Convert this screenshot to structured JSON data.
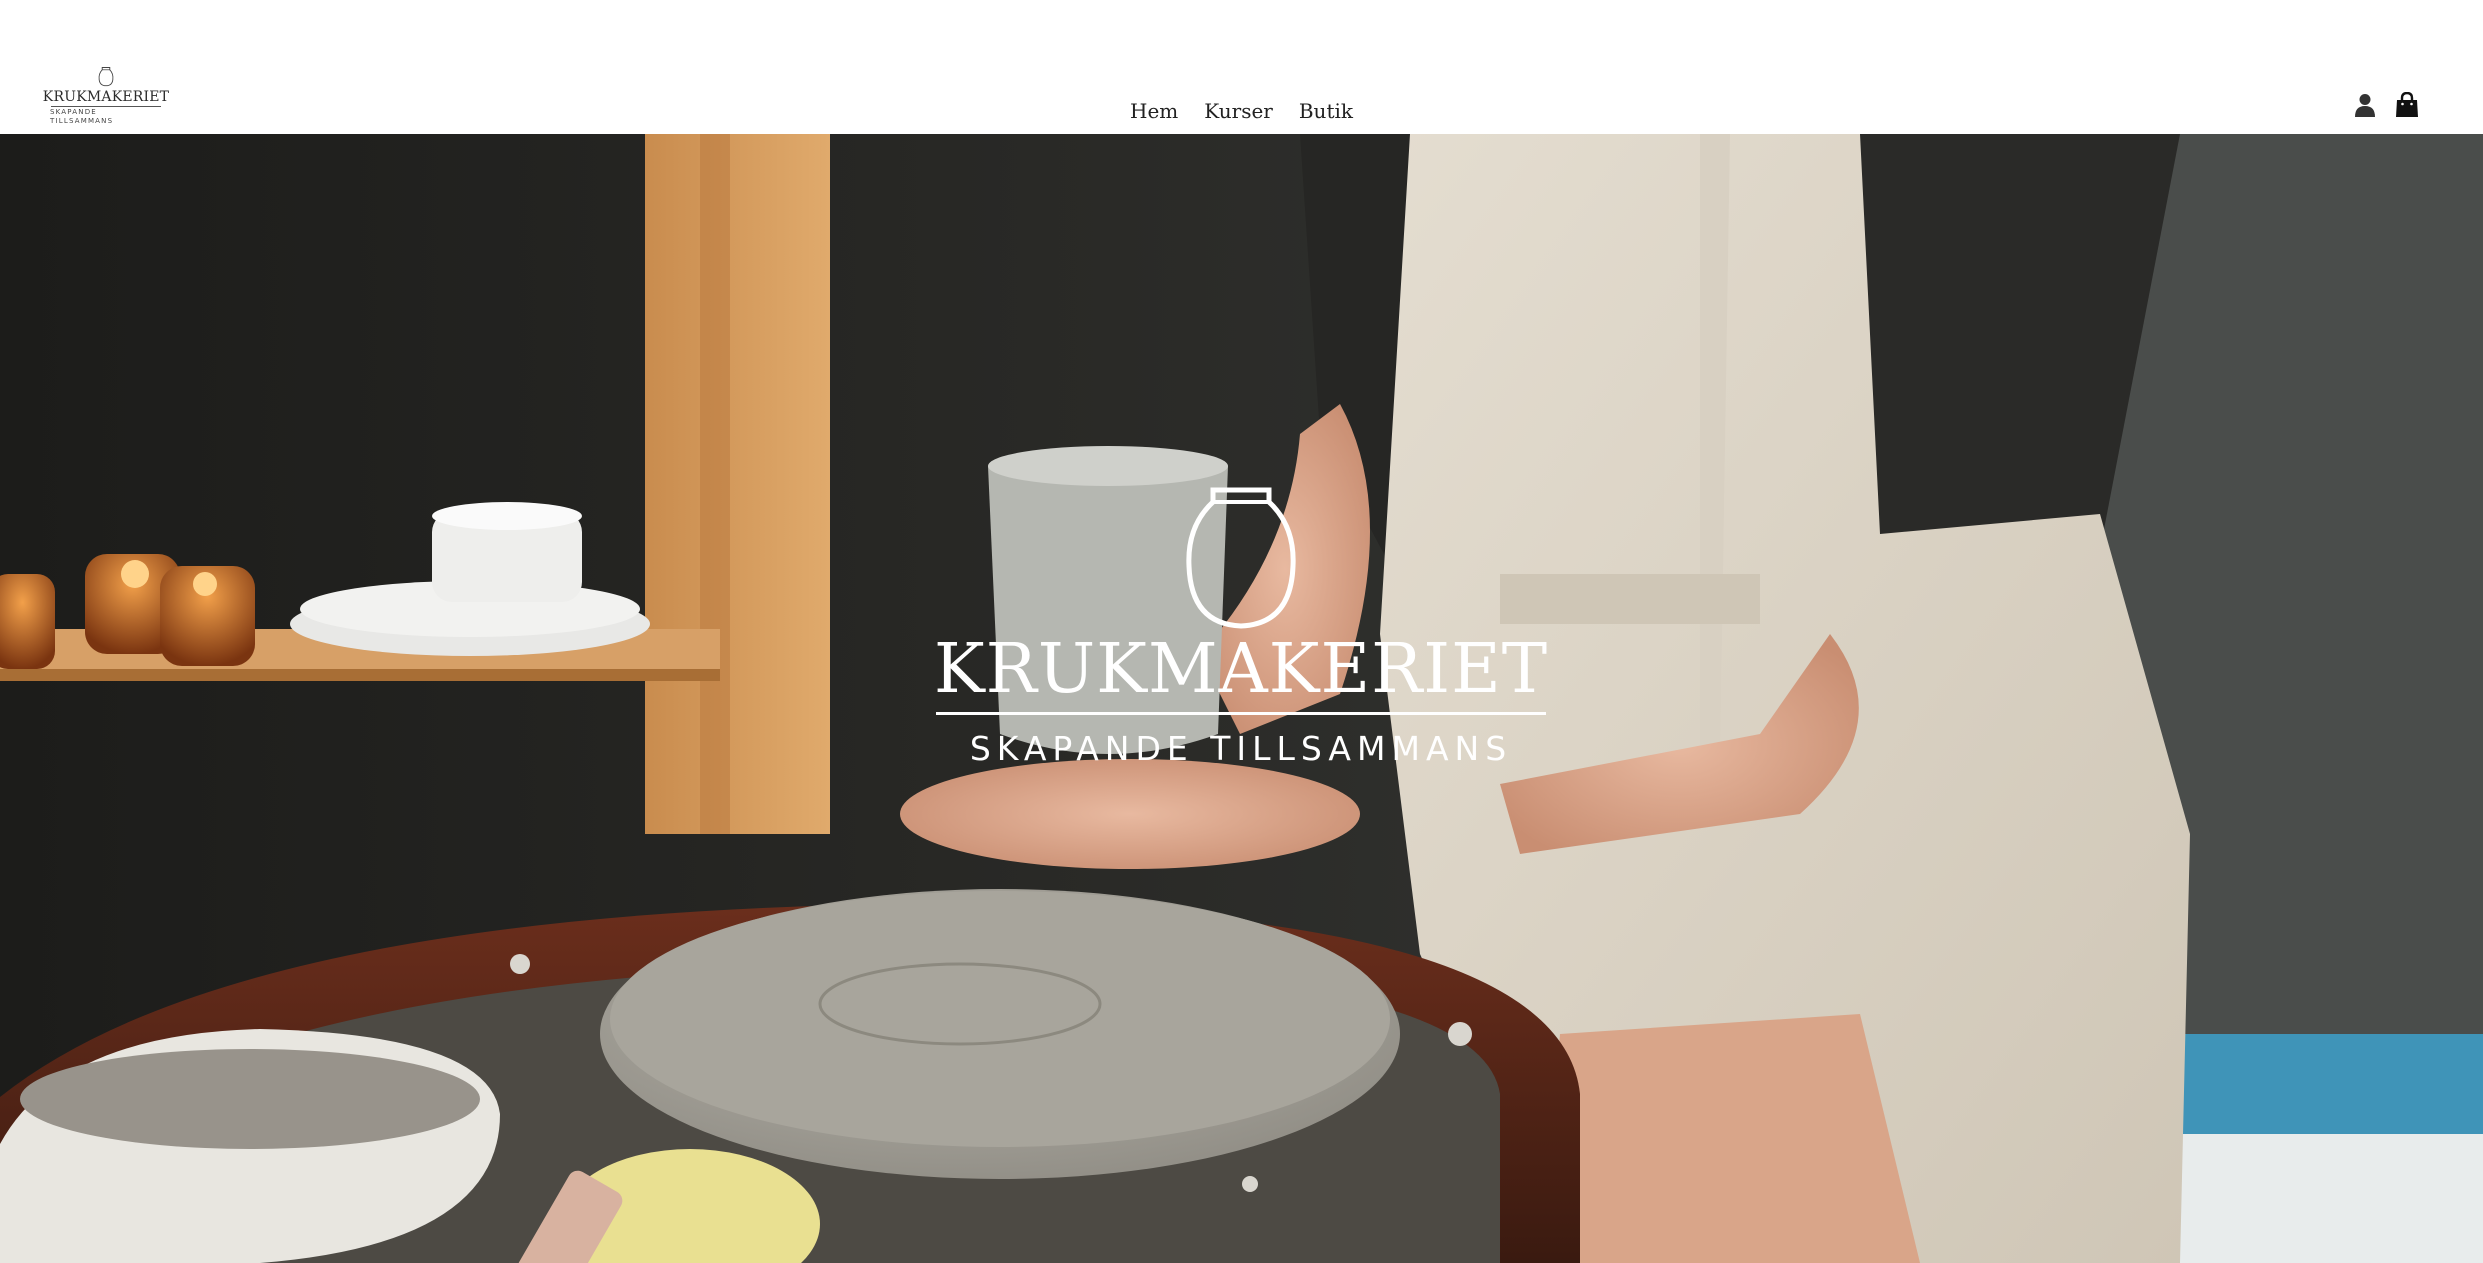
{
  "brand": {
    "name": "KRUKMAKERIET",
    "tagline": "SKAPANDE TILLSAMMANS"
  },
  "nav": {
    "items": [
      {
        "label": "Hem"
      },
      {
        "label": "Kurser"
      },
      {
        "label": "Butik"
      }
    ]
  },
  "header_icons": {
    "account": "user-icon",
    "cart": "shopping-bag-icon"
  },
  "hero": {
    "title": "KRUKMAKERIET",
    "tagline": "SKAPANDE TILLSAMMANS",
    "image": "pottery-wheel-photo"
  },
  "colors": {
    "header_bg": "#ffffff",
    "nav_text": "#222222",
    "icon": "#333333",
    "hero_text": "#ffffff"
  }
}
